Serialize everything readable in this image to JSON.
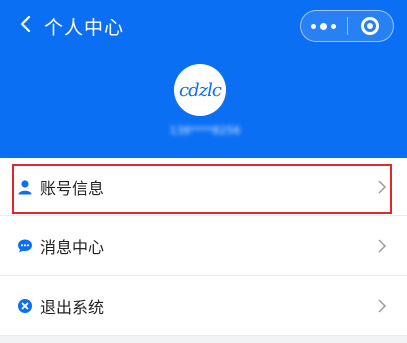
{
  "header": {
    "title": "个人中心",
    "back_icon": "chevron-left-icon",
    "more_icon": "more-dots-icon",
    "close_icon": "target-circle-icon",
    "background_color": "#0b6ff4"
  },
  "profile": {
    "avatar_text": "cdzlc",
    "phone": "138****8256"
  },
  "menu": {
    "items": [
      {
        "label": "账号信息",
        "icon": "user-icon",
        "icon_color": "#0b6ff4",
        "highlighted": true
      },
      {
        "label": "消息中心",
        "icon": "message-icon",
        "icon_color": "#0b6ff4"
      },
      {
        "label": "退出系统",
        "icon": "logout-x-icon",
        "icon_color": "#0b6ff4"
      }
    ]
  },
  "colors": {
    "accent": "#0b6ff4",
    "highlight_border": "#e4262b"
  }
}
